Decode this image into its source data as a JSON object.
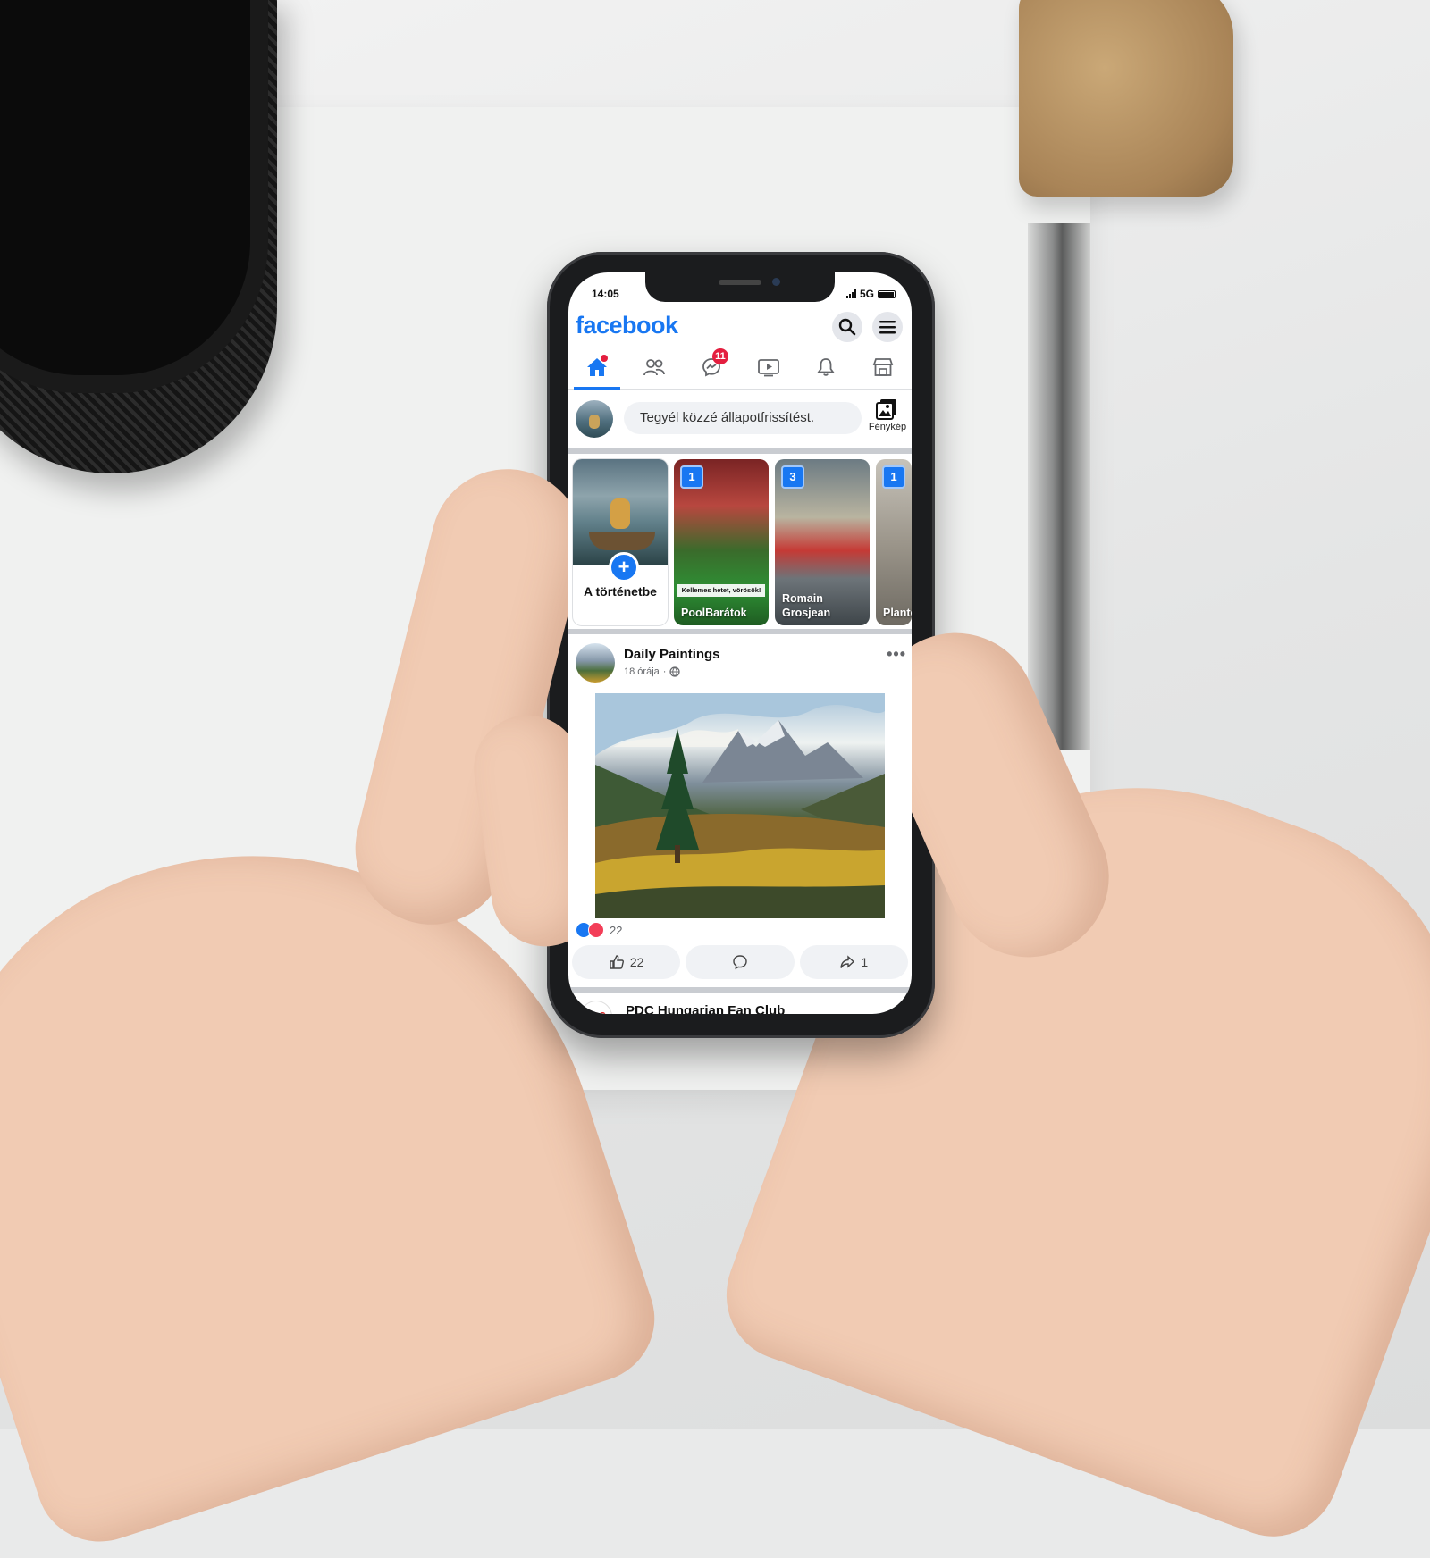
{
  "status_bar": {
    "time": "14:05",
    "network": "5G"
  },
  "header": {
    "logo": "facebook",
    "search_icon": "search-icon",
    "menu_icon": "menu-icon"
  },
  "nav": {
    "tabs": [
      {
        "name": "home",
        "icon": "home-icon",
        "active": true
      },
      {
        "name": "friends",
        "icon": "friends-icon"
      },
      {
        "name": "messenger",
        "icon": "messenger-icon",
        "badge": "11"
      },
      {
        "name": "watch",
        "icon": "video-icon"
      },
      {
        "name": "notifications",
        "icon": "bell-icon"
      },
      {
        "name": "marketplace",
        "icon": "store-icon"
      }
    ]
  },
  "composer": {
    "placeholder": "Tegyél közzé állapotfrissítést.",
    "photo_label": "Fénykép"
  },
  "stories": {
    "create_label": "A történetbe",
    "items": [
      {
        "count": "1",
        "caption": "Kellemes hetet, vörösök!",
        "name": "PoolBarátok"
      },
      {
        "count": "3",
        "name": "Romain Grosjean"
      },
      {
        "count": "1",
        "name": "Plante Buda"
      }
    ]
  },
  "post": {
    "author": "Daily Paintings",
    "time": "18 órája",
    "reactions_count": "22",
    "like_count": "22",
    "share_count": "1"
  },
  "next_post": {
    "author": "PDC Hungarian Fan Club",
    "logo_text": "PDC"
  },
  "colors": {
    "brand": "#1877f2",
    "badge": "#e41e3f",
    "love": "#f33e58"
  }
}
